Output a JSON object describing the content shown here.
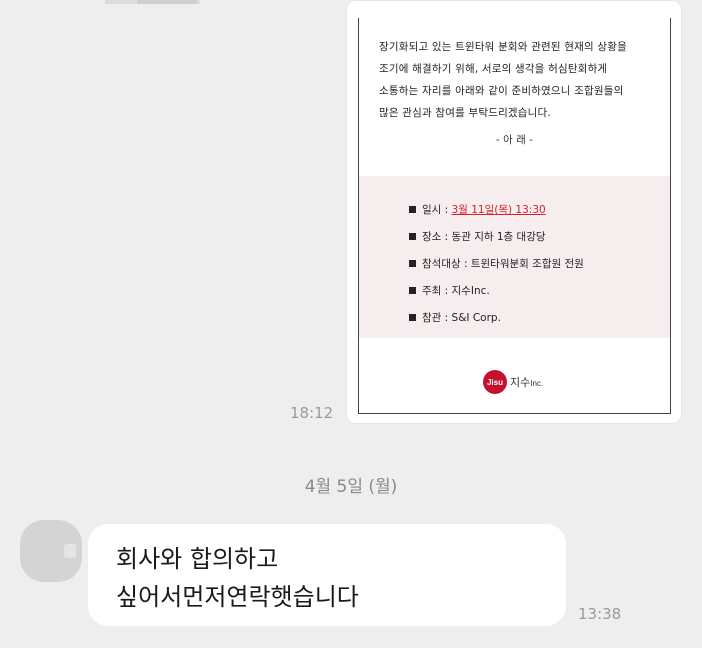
{
  "image_message": {
    "document": {
      "paragraph": [
        "장기화되고 있는 트윈타워 분회와 관련된 현재의 상황을",
        "조기에 해결하기 위해, 서로의 생각을 허심탄회하게",
        "소통하는 자리를 아래와 같이 준비하였으니 조합원들의",
        "많은 관심과 참여를 부탁드리겠습니다."
      ],
      "notice_label": "- 아 래 -",
      "details": [
        {
          "label": "일시 : ",
          "value": "3월 11일(목) 13:30"
        },
        {
          "label": "장소 : ",
          "value": "동관 지하 1층 대강당"
        },
        {
          "label": "참석대상 : ",
          "value": "트윈타워분회 조합원 전원"
        },
        {
          "label": "주최 : ",
          "value": "지수Inc."
        },
        {
          "label": "참관 : ",
          "value": "S&I Corp."
        }
      ],
      "logo": {
        "badge": "Jisu",
        "name": "지수",
        "suffix": "Inc."
      }
    },
    "timestamp": "18:12"
  },
  "date_divider": "4월 5일 (월)",
  "text_message": {
    "text": "회사와 합의하고\n싶어서먼저연락햇습니다",
    "timestamp": "13:38"
  },
  "colors": {
    "background": "#eeeeee",
    "bubble": "#ffffff",
    "highlight": "#d6202a",
    "logo": "#c4122e"
  }
}
